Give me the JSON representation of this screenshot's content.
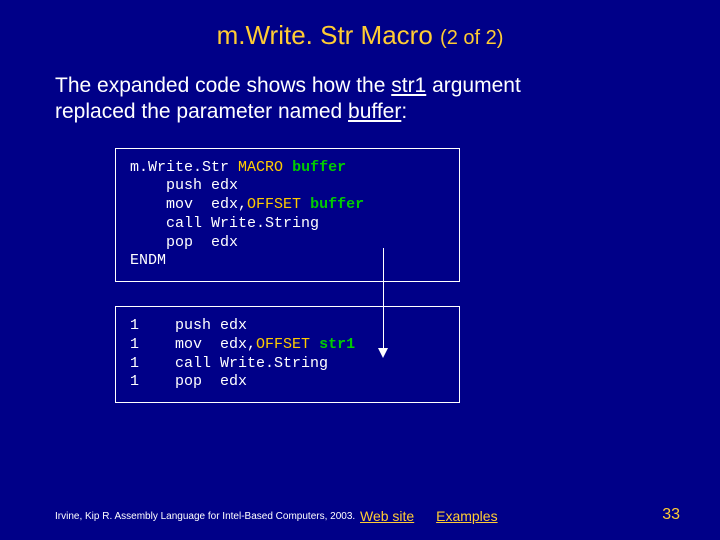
{
  "title": {
    "main": "m.Write. Str Macro",
    "sub": "(2 of 2)"
  },
  "body": {
    "line1_pre": "The expanded code shows how the ",
    "line1_u": "str1",
    "line1_post": " argument",
    "line2_pre": "replaced the parameter named ",
    "line2_u": "buffer",
    "line2_post": ":"
  },
  "code1": {
    "l1a": "m.Write.Str ",
    "l1b": "MACRO",
    "l1c": " ",
    "l1d": "buffer",
    "l2": "    push edx",
    "l3a": "    mov  edx,",
    "l3b": "OFFSET",
    "l3c": " ",
    "l3d": "buffer",
    "l4": "    call Write.String",
    "l5": "    pop  edx",
    "l6": "ENDM"
  },
  "code2": {
    "l1": "1    push edx",
    "l2a": "1    mov  edx,",
    "l2b": "OFFSET",
    "l2c": " ",
    "l2d": "str1",
    "l3": "1    call Write.String",
    "l4": "1    pop  edx"
  },
  "footer": {
    "cite": "Irvine, Kip R. Assembly Language for Intel-Based Computers, 2003.",
    "link1": "Web site",
    "link2": "Examples",
    "page": "33"
  }
}
